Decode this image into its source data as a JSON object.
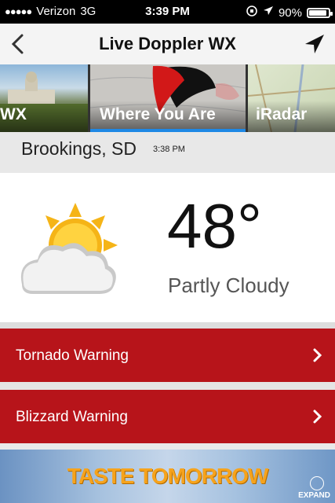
{
  "status_bar": {
    "signal": "●●●●●",
    "carrier": "Verizon",
    "network": "3G",
    "time": "3:39 PM",
    "battery": "90%",
    "battery_level": 0.9
  },
  "header": {
    "title": "Live Doppler WX",
    "back_icon": "chevron-left-icon",
    "nav_icon": "location-arrow-icon"
  },
  "tiles": [
    {
      "label": "WX"
    },
    {
      "label": "Where You Are",
      "selected": true
    },
    {
      "label": "iRadar"
    }
  ],
  "location": {
    "city": "Brookings, SD",
    "updated": "3:38 PM"
  },
  "current": {
    "temperature": "48°",
    "condition": "Partly Cloudy",
    "icon": "partly-cloudy-icon"
  },
  "warnings": [
    {
      "label": "Tornado Warning"
    },
    {
      "label": "Blizzard Warning"
    }
  ],
  "ad": {
    "text": "TASTE TOMORROW",
    "expand": "EXPAND"
  },
  "colors": {
    "warning": "#b7141a",
    "tab_indicator": "#1e88e5",
    "ad_text": "#f6a31c"
  }
}
